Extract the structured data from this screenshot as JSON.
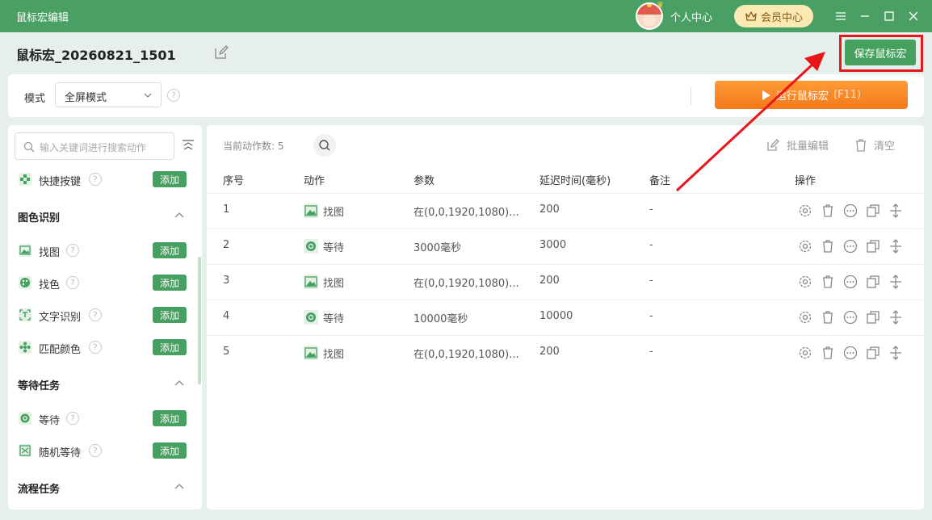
{
  "window": {
    "title": "鼠标宏编辑",
    "user_center": "个人中心",
    "vip_label": "会员中心"
  },
  "macro": {
    "name": "鼠标宏_20260821_1501",
    "save_label": "保存鼠标宏"
  },
  "mode": {
    "label": "模式",
    "value": "全屏模式",
    "run_label": "运行鼠标宏",
    "run_key": "(F11)"
  },
  "sidebar": {
    "search_placeholder": "输入关键词进行搜索动作",
    "add_label": "添加",
    "top_item": {
      "label": "快捷按键",
      "icon": "shortcut-key-icon"
    },
    "sections": [
      {
        "title": "图色识别",
        "items": [
          {
            "label": "找图",
            "icon": "image-icon"
          },
          {
            "label": "找色",
            "icon": "palette-icon"
          },
          {
            "label": "文字识别",
            "icon": "ocr-icon"
          },
          {
            "label": "匹配颜色",
            "icon": "color-match-icon"
          }
        ]
      },
      {
        "title": "等待任务",
        "items": [
          {
            "label": "等待",
            "icon": "wait-icon"
          },
          {
            "label": "随机等待",
            "icon": "random-wait-icon"
          }
        ]
      },
      {
        "title": "流程任务",
        "items": []
      }
    ]
  },
  "table": {
    "count_label": "当前动作数:",
    "count": "5",
    "batch_edit": "批量编辑",
    "clear": "清空",
    "headers": [
      "序号",
      "动作",
      "参数",
      "延迟时间(毫秒)",
      "备注",
      "操作"
    ],
    "rows": [
      {
        "no": "1",
        "action": "找图",
        "action_icon": "image-icon",
        "param": "在(0,0,1920,1080)...",
        "delay": "200",
        "note": "-"
      },
      {
        "no": "2",
        "action": "等待",
        "action_icon": "wait-icon",
        "param": "3000毫秒",
        "delay": "3000",
        "note": "-"
      },
      {
        "no": "3",
        "action": "找图",
        "action_icon": "image-icon",
        "param": "在(0,0,1920,1080)...",
        "delay": "200",
        "note": "-"
      },
      {
        "no": "4",
        "action": "等待",
        "action_icon": "wait-icon",
        "param": "10000毫秒",
        "delay": "10000",
        "note": "-"
      },
      {
        "no": "5",
        "action": "找图",
        "action_icon": "image-icon",
        "param": "在(0,0,1920,1080)...",
        "delay": "200",
        "note": "-"
      }
    ]
  },
  "colors": {
    "brand_green": "#4aa064",
    "run_orange": "#f7871f",
    "highlight_red": "#e8151b"
  }
}
